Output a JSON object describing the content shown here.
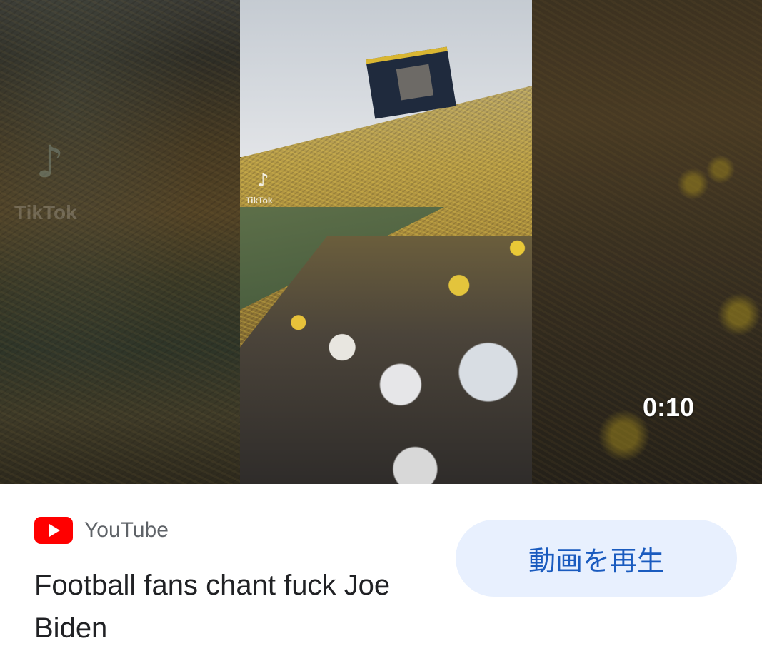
{
  "thumbnail": {
    "duration": "0:10",
    "watermark_label": "TikTok",
    "watermark_icon": "tiktok-note-icon",
    "colors": {
      "crowd_yellow": "#e3c43c",
      "sky": "#d6dadf"
    }
  },
  "source": {
    "name": "YouTube",
    "icon": "youtube-logo-icon",
    "icon_color": "#ff0000"
  },
  "video": {
    "title": "Football fans chant fuck Joe Biden"
  },
  "actions": {
    "play_label": "動画を再生",
    "play_button_bg": "#e8f0fe",
    "play_button_text_color": "#1a5bbf"
  }
}
